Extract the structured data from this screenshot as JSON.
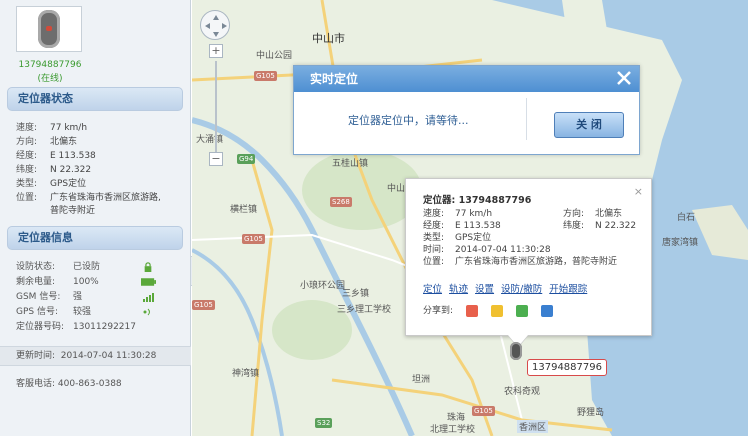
{
  "device": {
    "id": "13794887796",
    "status": "(在线)"
  },
  "status_section": {
    "title": "定位器状态",
    "rows": [
      {
        "key": "速度:",
        "value": "77 km/h"
      },
      {
        "key": "方向:",
        "value": "北偏东"
      },
      {
        "key": "经度:",
        "value": "E 113.538"
      },
      {
        "key": "纬度:",
        "value": "N 22.322"
      },
      {
        "key": "类型:",
        "value": "GPS定位"
      },
      {
        "key": "位置:",
        "value": "广东省珠海市香洲区旅游路,"
      },
      {
        "key": "",
        "value": "普陀寺附近"
      }
    ]
  },
  "info_section": {
    "title": "定位器信息",
    "rows": [
      {
        "key": "设防状态:",
        "value": "已设防",
        "icon": "lock-icon"
      },
      {
        "key": "剩余电量:",
        "value": "100%",
        "icon": "battery-icon"
      },
      {
        "key": "GSM 信号:",
        "value": "强",
        "icon": "signal-icon"
      },
      {
        "key": "GPS 信号:",
        "value": "较强",
        "icon": "gps-signal-icon"
      },
      {
        "key": "定位器号码:",
        "value": "13011292217"
      }
    ]
  },
  "update_time": {
    "key": "更新时间:",
    "value": "2014-07-04 11:30:28"
  },
  "hotline": "客服电话: 400-863-0388",
  "collapse_glyph": "◀",
  "map": {
    "labels": [
      {
        "text": "中山公园"
      },
      {
        "text": "中山市"
      },
      {
        "text": "大涌镇"
      },
      {
        "text": "三乡镇"
      },
      {
        "text": "五桂山镇"
      },
      {
        "text": "中山鳌园"
      },
      {
        "text": "横栏镇"
      },
      {
        "text": "坦洲"
      },
      {
        "text": "珠海"
      },
      {
        "text": "三乡理工学校"
      },
      {
        "text": "小琅环公园"
      },
      {
        "text": "白石"
      },
      {
        "text": "唐家湾镇"
      },
      {
        "text": "农科奇观"
      },
      {
        "text": "野狸岛"
      },
      {
        "text": "香洲区"
      },
      {
        "text": "北理工学校"
      },
      {
        "text": "神湾镇"
      }
    ],
    "highways": [
      "G105",
      "G94",
      "S268",
      "G105",
      "G105",
      "G105",
      "S32"
    ]
  },
  "locate_dialog": {
    "title": "实时定位",
    "message": "定位器定位中，请等待...",
    "close_button": "关 闭"
  },
  "popup": {
    "title": "定位器: 13794887796",
    "rows": [
      {
        "k": "速度:",
        "v": "77 km/h",
        "k2": "方向:",
        "v2": "北偏东"
      },
      {
        "k": "经度:",
        "v": "E 113.538",
        "k2": "纬度:",
        "v2": "N 22.322"
      },
      {
        "k": "类型:",
        "v": "GPS定位"
      },
      {
        "k": "时间:",
        "v": "2014-07-04 11:30:28"
      },
      {
        "k": "位置:",
        "v": "广东省珠海市香洲区旅游路，普陀寺附近"
      }
    ],
    "links": [
      "定位",
      "轨迹",
      "设置",
      "设防/撤防",
      "开始跟踪"
    ],
    "share_label": "分享到:",
    "close_glyph": "×"
  },
  "marker_label": "13794887796",
  "colors": {
    "accent": "#4e8fd2",
    "online": "#3a9a2f",
    "link": "#1d4fa0",
    "marker_border": "#d84a4a"
  }
}
